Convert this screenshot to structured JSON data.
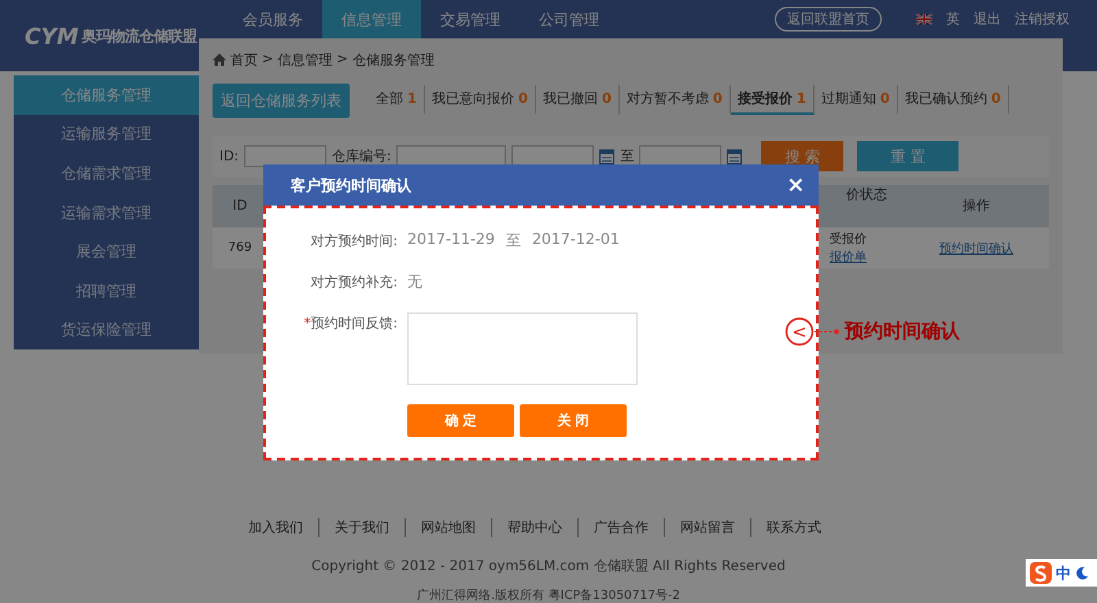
{
  "header": {
    "logo_mark": "CYM",
    "logo_text": "奥玛物流仓储联盟",
    "nav": [
      {
        "label": "会员服务",
        "selected": false
      },
      {
        "label": "信息管理",
        "selected": true
      },
      {
        "label": "交易管理",
        "selected": false
      },
      {
        "label": "公司管理",
        "selected": false
      }
    ],
    "home_button": "返回联盟首页",
    "links": [
      "英",
      "退出",
      "注销授权"
    ]
  },
  "breadcrumb": [
    {
      "label": "首页"
    },
    {
      "separator": ">",
      "label": "信息管理"
    },
    {
      "separator": ">",
      "label": "仓储服务管理"
    }
  ],
  "sidebar": {
    "items": [
      {
        "label": "仓储服务管理",
        "selected": true
      },
      {
        "label": "运输服务管理",
        "selected": false
      },
      {
        "label": "仓储需求管理",
        "selected": false
      },
      {
        "label": "运输需求管理",
        "selected": false
      },
      {
        "label": "展会管理",
        "selected": false
      },
      {
        "label": "招聘管理",
        "selected": false
      },
      {
        "label": "货运保险管理",
        "selected": false
      }
    ]
  },
  "back_button": "返回仓储服务列表",
  "tabs": [
    {
      "label": "全部",
      "count": "1",
      "selected": false
    },
    {
      "label": "我已意向报价",
      "count": "0",
      "selected": false
    },
    {
      "label": "我已撤回",
      "count": "0",
      "selected": false
    },
    {
      "label": "对方暂不考虑",
      "count": "0",
      "selected": false
    },
    {
      "label": "接受报价",
      "count": "1",
      "selected": true
    },
    {
      "label": "过期通知",
      "count": "0",
      "selected": false
    },
    {
      "label": "我已确认预约",
      "count": "0",
      "selected": false
    }
  ],
  "filters": {
    "id_label": "ID:",
    "warehouse_label": "仓库编号:",
    "to_label": "至",
    "search_button": "搜 索",
    "reset_button": "重 置"
  },
  "table": {
    "columns": [
      "ID",
      "价状态",
      "操作"
    ],
    "rows": [
      {
        "id": "769",
        "status": "受报价",
        "status_link": "报价单",
        "action": "预约时间确认"
      }
    ]
  },
  "dialog": {
    "title": "客户预约时间确认",
    "close": "×",
    "fields": [
      {
        "kind": "text",
        "label": "对方预约时间:",
        "value_from": "2017-11-29",
        "separator": "至",
        "value_to": "2017-12-01"
      },
      {
        "kind": "plain",
        "label": "对方预约补充:",
        "value": "无"
      },
      {
        "kind": "textarea",
        "label": "预约时间反馈:",
        "required": true,
        "required_mark": "*"
      }
    ],
    "buttons": [
      "确 定",
      "关 闭"
    ]
  },
  "callout": {
    "symbol": "<",
    "text": "预约时间确认"
  },
  "footer": {
    "links": [
      "加入我们",
      "关于我们",
      "网站地图",
      "帮助中心",
      "广告合作",
      "网站留言",
      "联系方式"
    ],
    "copyright": "Copyright © 2012 - 2017 oym56LM.com  仓储联盟  All Rights Reserved",
    "icp": "广州汇得网络.版权所有  粤ICP备13050717号-2"
  },
  "ime": {
    "label": "中"
  }
}
